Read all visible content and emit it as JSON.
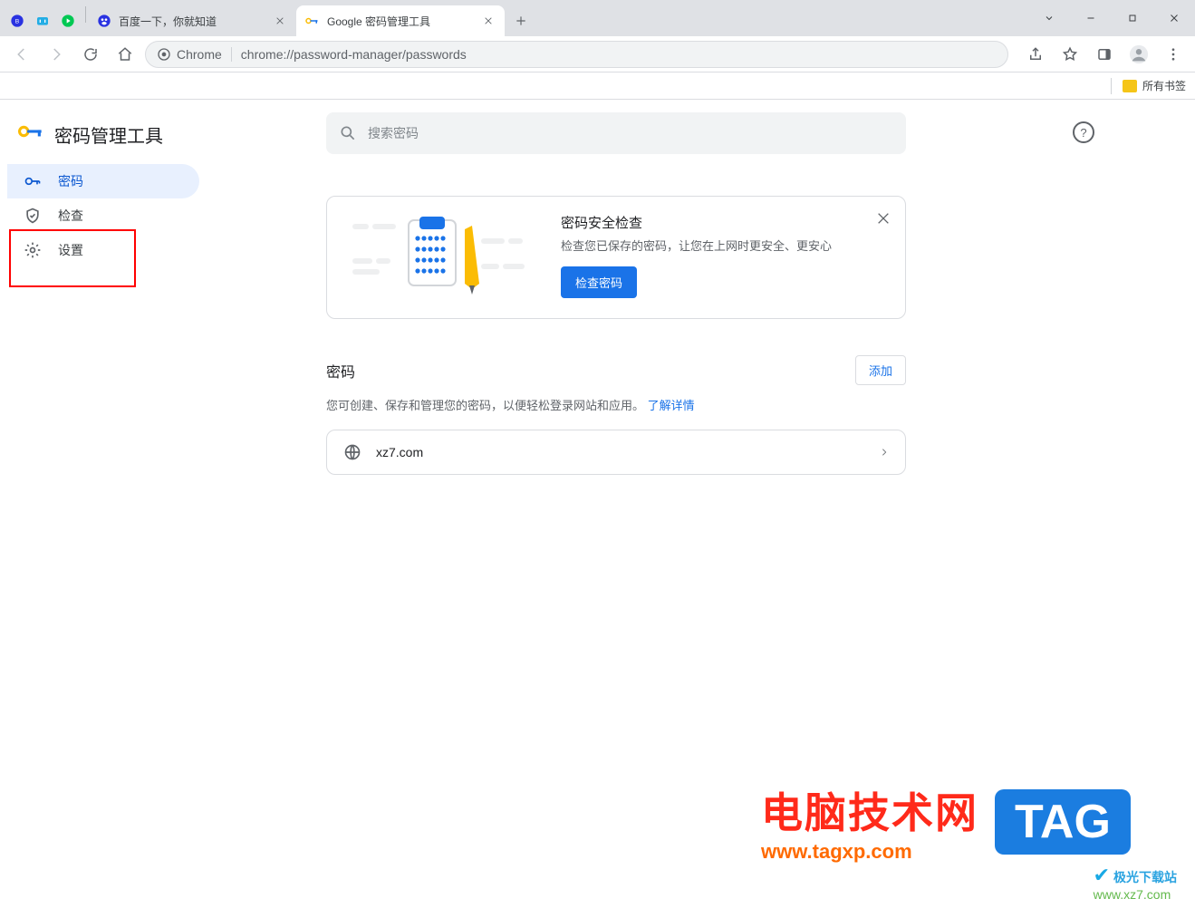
{
  "window_controls": {
    "dropdown": "⌄"
  },
  "tabs": [
    {
      "title": "百度一下，你就知道",
      "favicon": "baidu"
    },
    {
      "title": "Google 密码管理工具",
      "favicon": "gpm"
    }
  ],
  "toolbar": {
    "chrome_label": "Chrome",
    "url": "chrome://password-manager/passwords"
  },
  "bookmarks": {
    "all_label": "所有书签"
  },
  "brand": {
    "title": "密码管理工具"
  },
  "sidebar": [
    {
      "id": "passwords",
      "label": "密码"
    },
    {
      "id": "check",
      "label": "检查"
    },
    {
      "id": "settings",
      "label": "设置"
    }
  ],
  "search": {
    "placeholder": "搜索密码"
  },
  "checkup_card": {
    "title": "密码安全检查",
    "desc": "检查您已保存的密码，让您在上网时更安全、更安心",
    "button": "检查密码"
  },
  "section": {
    "title": "密码",
    "add": "添加",
    "desc": "您可创建、保存和管理您的密码，以便轻松登录网站和应用。",
    "learn_more": "了解详情"
  },
  "password_rows": [
    {
      "site": "xz7.com"
    }
  ],
  "watermark": {
    "line1": "电脑技术网",
    "line2": "www.tagxp.com",
    "tag": "TAG",
    "jg1": "极光下载站",
    "jg2": "www.xz7.com"
  }
}
